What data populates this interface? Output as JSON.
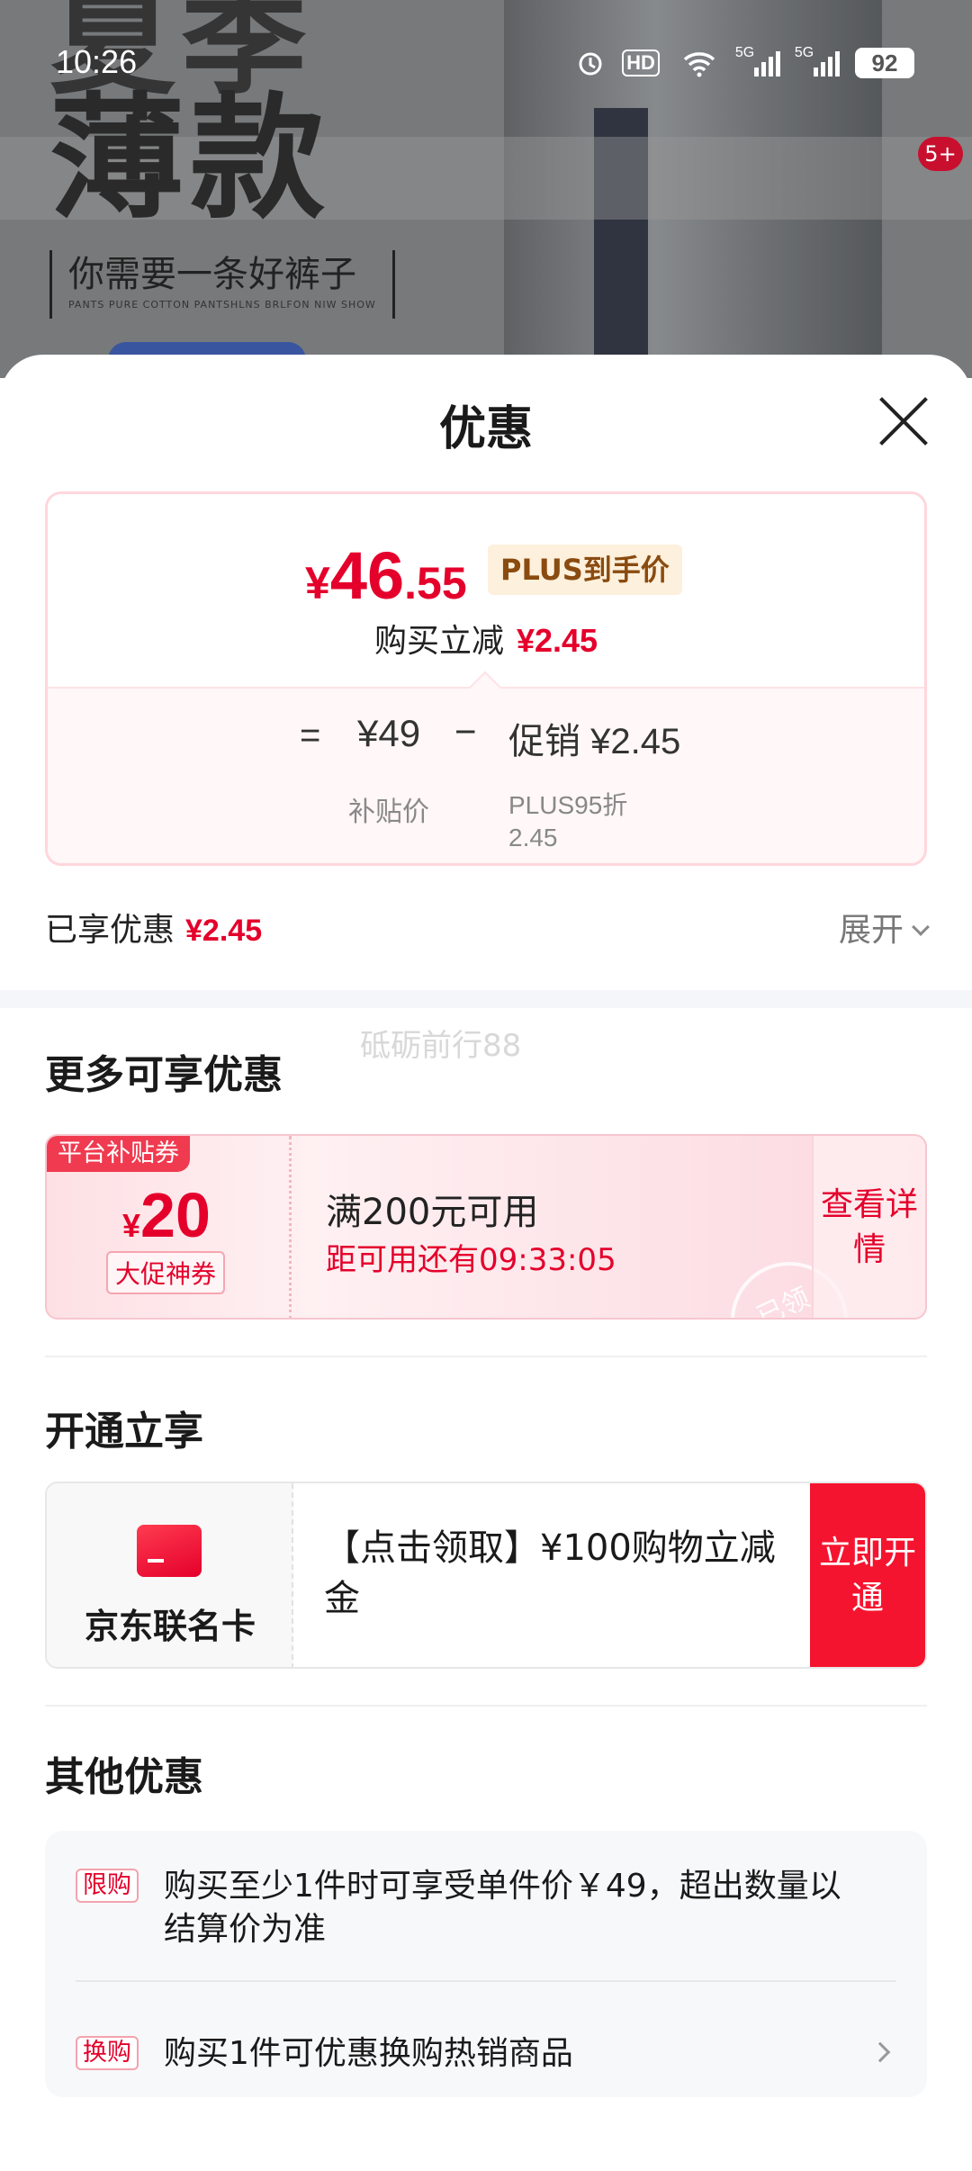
{
  "background": {
    "headline_1": "夏季",
    "headline_2": "薄款",
    "slogan": "你需要一条好裤子",
    "slogan_en": "PANTS PURE COTTON PANTSHLNS BRLFON NIW SHOW",
    "badge": "5+"
  },
  "status_bar": {
    "time": "10:26",
    "hd_label": "HD",
    "signal_1": "5G",
    "signal_2": "5G",
    "battery": "92",
    "icons": [
      "alarm-icon",
      "hd-icon",
      "wifi-icon",
      "signal-icon",
      "signal-icon",
      "battery-icon"
    ]
  },
  "sheet": {
    "title": "优惠",
    "close_icon": "close-icon"
  },
  "price_card": {
    "currency": "¥",
    "price_int": "46",
    "price_dec": ".55",
    "plus_tag": "PLUS到手价",
    "reduce_label": "购买立减",
    "reduce_value": "¥2.45",
    "equals": "=",
    "base_price": "¥49",
    "base_label": "补贴价",
    "minus": "−",
    "promo_label": "促销 ¥2.45",
    "promo_sub": "PLUS95折\n2.45"
  },
  "enjoyed": {
    "label": "已享优惠",
    "value": "¥2.45",
    "expand_label": "展开"
  },
  "watermark": "砥砺前行88",
  "more_section": {
    "title": "更多可享优惠",
    "coupon": {
      "tag": "平台补贴券",
      "currency": "¥",
      "amount": "20",
      "type": "大促神券",
      "condition": "满200元可用",
      "countdown": "距可用还有09:33:05",
      "stamp": "已领",
      "detail_button": "查看详情"
    }
  },
  "open_section": {
    "title": "开通立享",
    "card_name": "京东联名卡",
    "card_desc": "【点击领取】¥100购物立减金",
    "open_button": "立即开通"
  },
  "other_section": {
    "title": "其他优惠",
    "items": [
      {
        "tag": "限购",
        "text": "购买至少1件时可享受单件价￥49，超出数量以结算价为准"
      },
      {
        "tag": "换购",
        "text": "购买1件可优惠换购热销商品"
      }
    ]
  },
  "colors": {
    "accent_red": "#e4002b",
    "button_red": "#f5142f",
    "plus_gold_bg": "#fdf0dc"
  }
}
